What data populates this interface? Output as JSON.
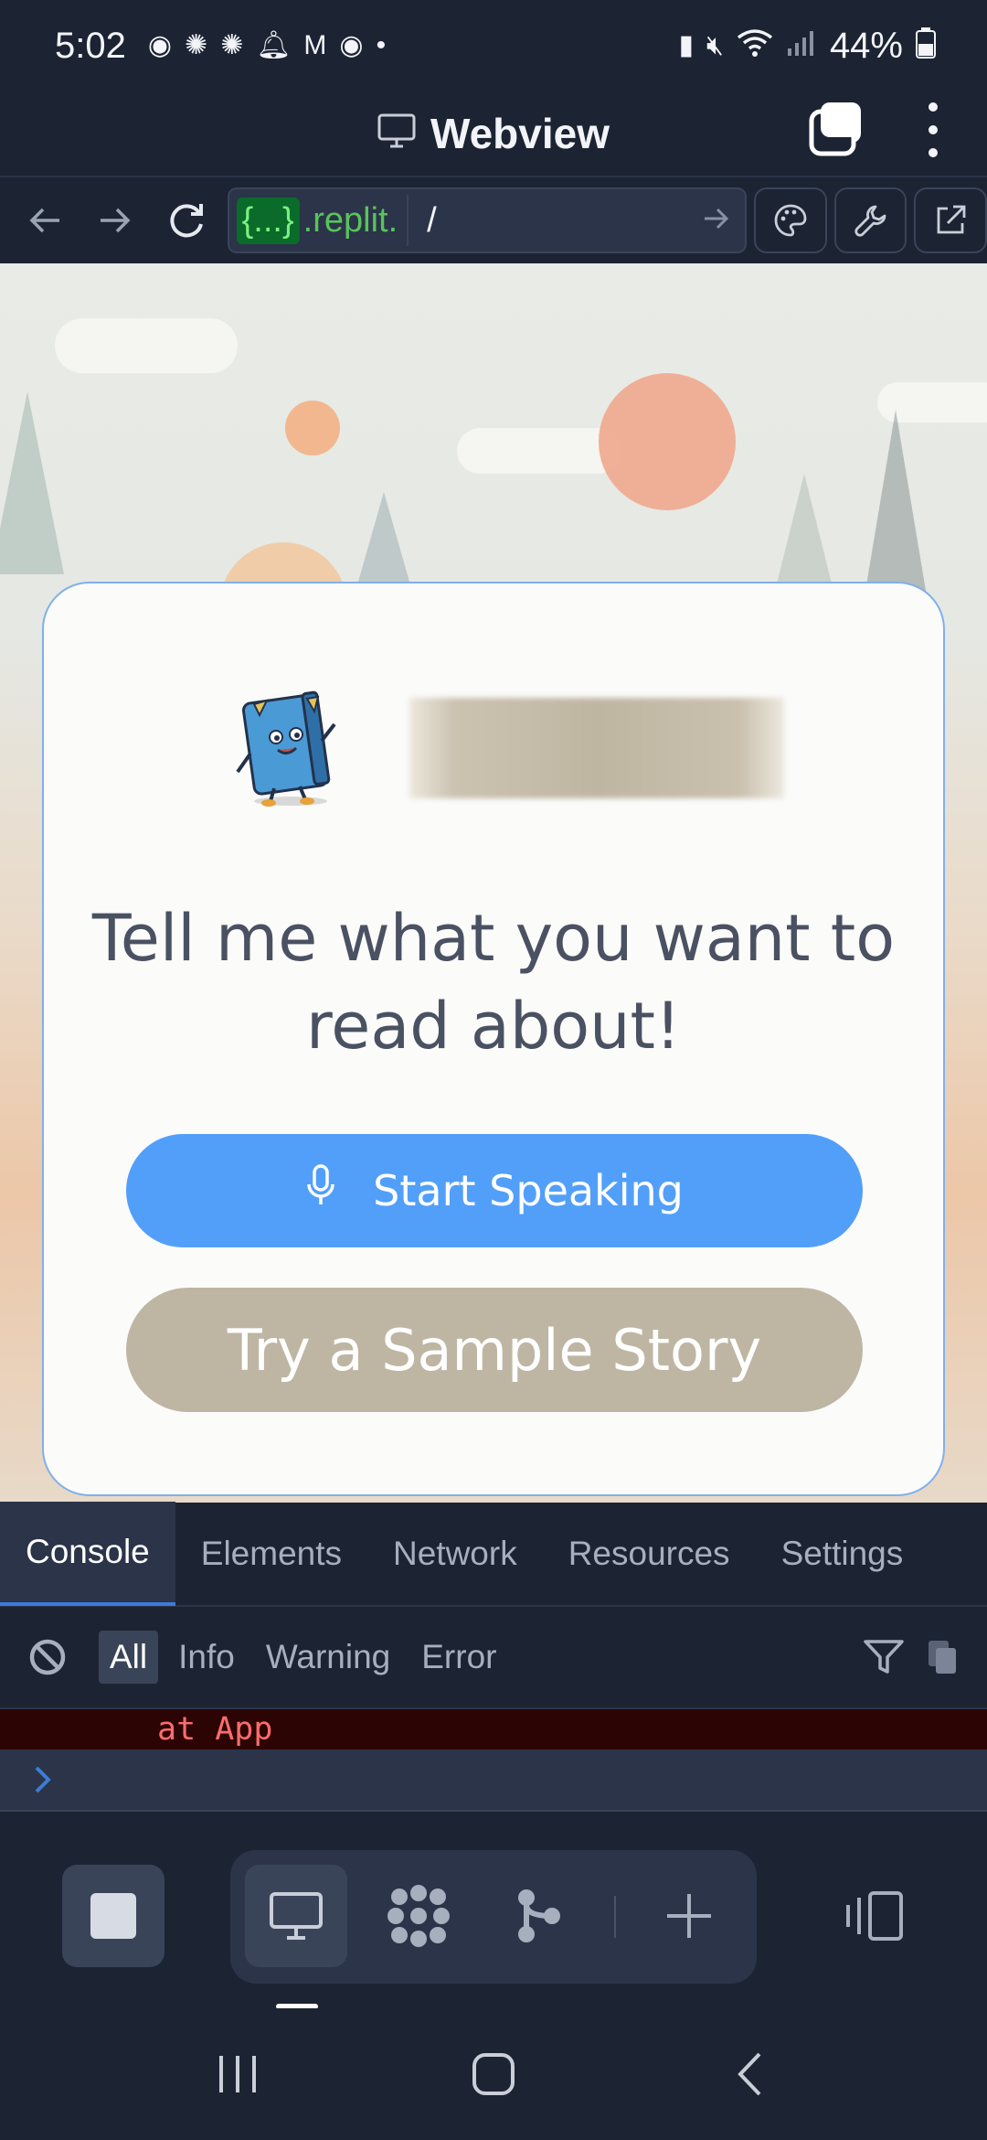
{
  "status_bar": {
    "time": "5:02",
    "battery": "44%",
    "dot": "•"
  },
  "title_bar": {
    "title": "Webview"
  },
  "url_bar": {
    "host_badge": "{...}",
    "host": ".replit.",
    "path": "/"
  },
  "page": {
    "headline": "Tell me what you want to read about!",
    "start_speaking_label": "Start Speaking",
    "sample_story_label": "Try a Sample Story"
  },
  "devtools": {
    "tabs": [
      "Console",
      "Elements",
      "Network",
      "Resources",
      "Settings"
    ],
    "active_tab": "Console",
    "filters": [
      "All",
      "Info",
      "Warning",
      "Error"
    ],
    "active_filter": "All",
    "log_line": "at App"
  },
  "colors": {
    "accent_blue": "#529ffa",
    "sample_button": "#beb6a3",
    "background": "#1c2333",
    "error_bg": "#2c0404",
    "error_text": "#ff6c6c"
  }
}
